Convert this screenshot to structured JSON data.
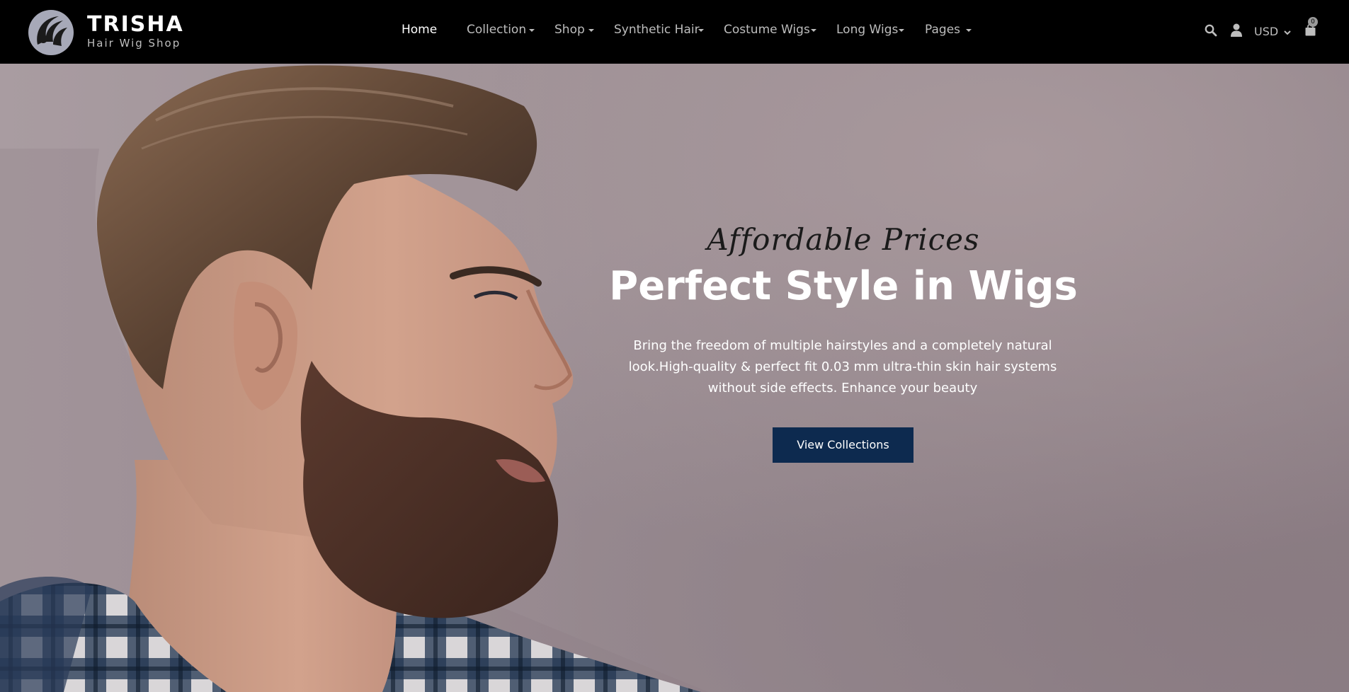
{
  "brand": {
    "name": "TRISHA",
    "tagline": "Hair Wig Shop"
  },
  "nav": {
    "items": [
      {
        "label": "Home",
        "active": true,
        "dropdown": false
      },
      {
        "label": "Collection",
        "active": false,
        "dropdown": true
      },
      {
        "label": "Shop",
        "active": false,
        "dropdown": true
      },
      {
        "label": "Synthetic Hair",
        "active": false,
        "dropdown": true
      },
      {
        "label": "Costume Wigs",
        "active": false,
        "dropdown": true
      },
      {
        "label": "Long Wigs",
        "active": false,
        "dropdown": true
      },
      {
        "label": "Pages",
        "active": false,
        "dropdown": true
      }
    ]
  },
  "header_tools": {
    "search_icon": "search-icon",
    "account_icon": "user-icon",
    "currency": "USD",
    "cart_icon": "shopping-bag-icon",
    "cart_count": "0"
  },
  "hero": {
    "script_heading": "Affordable Prices",
    "title": "Perfect Style in Wigs",
    "description": "Bring the freedom of multiple hairstyles and a completely natural look.High-quality & perfect fit 0.03 mm ultra-thin skin hair systems without side effects. Enhance your beauty",
    "cta_label": "View Collections"
  },
  "colors": {
    "header_bg": "#000000",
    "nav_text": "#bdbdbd",
    "nav_active": "#ffffff",
    "cta_bg": "#0d2a4f",
    "hero_bg": "#9c8f95"
  }
}
